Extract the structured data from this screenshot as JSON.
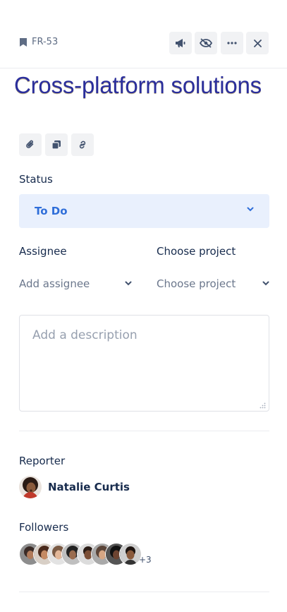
{
  "header": {
    "issue_key": "FR-53",
    "icons": [
      "bookmark-icon",
      "megaphone-icon",
      "eye-off-icon",
      "more-icon",
      "close-icon"
    ]
  },
  "issue": {
    "title": "Cross-platform solutions"
  },
  "toolbar": {
    "icons": [
      "attachment-icon",
      "copy-icon",
      "link-icon"
    ]
  },
  "status": {
    "label": "Status",
    "value": "To Do"
  },
  "assignee": {
    "label": "Assignee",
    "value": "Add assignee"
  },
  "project": {
    "label": "Choose project",
    "value": "Choose project"
  },
  "description": {
    "placeholder": "Add a description"
  },
  "reporter": {
    "label": "Reporter",
    "name": "Natalie Curtis"
  },
  "followers": {
    "label": "Followers",
    "more": "+3"
  },
  "colors": {
    "accent": "#2f6ed9",
    "status_bg": "#e9f0fd",
    "title": "#2b2f9d"
  }
}
